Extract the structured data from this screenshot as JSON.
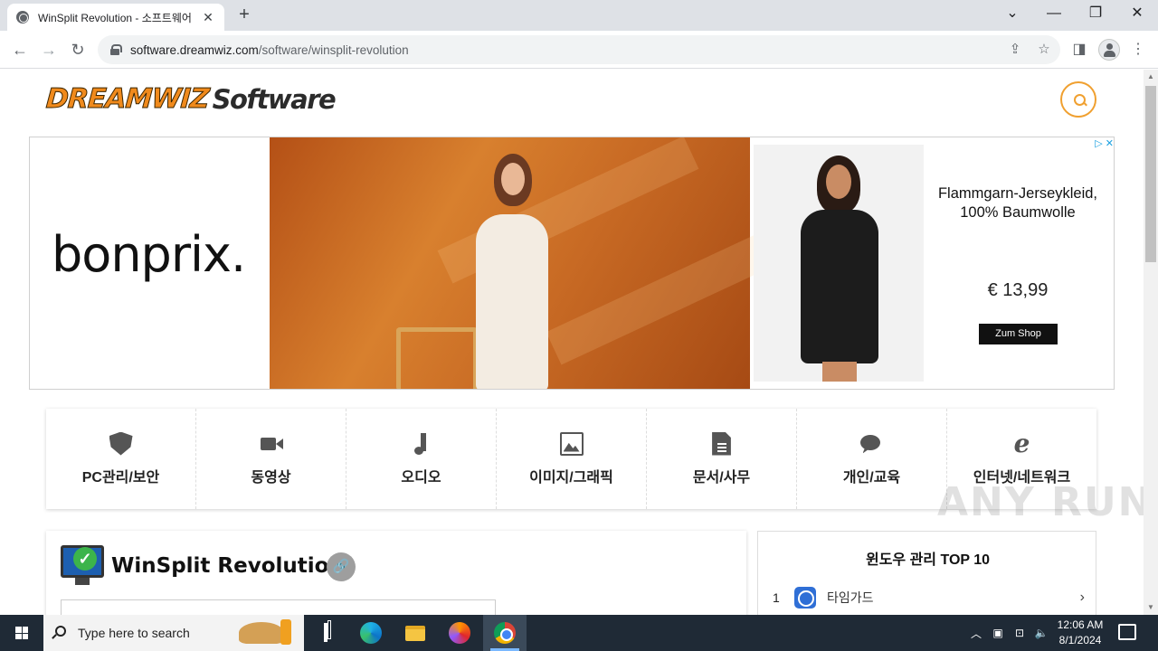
{
  "browser": {
    "tab_title": "WinSplit Revolution - 소프트웨어",
    "tab_close": "✕",
    "new_tab": "+",
    "url_host": "software.dreamwiz.com",
    "url_path": "/software/winsplit-revolution",
    "window_controls": {
      "chevron": "⌄",
      "minimize": "—",
      "restore": "❐",
      "close": "✕"
    },
    "nav": {
      "back": "←",
      "forward": "→",
      "reload": "↻"
    },
    "toolbar": {
      "share": "⇪",
      "bookmark": "☆",
      "sidepanel": "◨",
      "menu": "⋮"
    }
  },
  "site": {
    "logo_part1": "DREAMWIZ",
    "logo_part2": "Software"
  },
  "ad": {
    "brand": "bonprix.",
    "product_title": "Flammgarn-Jerseykleid, 100% Baumwolle",
    "price": "€ 13,99",
    "cta": "Zum Shop",
    "adchoices": "▷ ✕"
  },
  "categories": [
    {
      "label": "PC관리/보안",
      "icon": "shield-icon"
    },
    {
      "label": "동영상",
      "icon": "video-icon"
    },
    {
      "label": "오디오",
      "icon": "music-icon"
    },
    {
      "label": "이미지/그래픽",
      "icon": "image-icon"
    },
    {
      "label": "문서/사무",
      "icon": "document-icon"
    },
    {
      "label": "개인/교육",
      "icon": "chat-icon"
    },
    {
      "label": "인터넷/네트워크",
      "icon": "ie-icon"
    }
  ],
  "main": {
    "app_title": "WinSplit Revolution",
    "link_icon": "🔗"
  },
  "sidebar": {
    "title": "윈도우 관리 TOP 10",
    "items": [
      {
        "rank": "1",
        "name": "타임가드",
        "arrow": "›"
      }
    ]
  },
  "watermark": "ANY RUN",
  "taskbar": {
    "search_placeholder": "Type here to search",
    "time": "12:06 AM",
    "date": "8/1/2024"
  }
}
